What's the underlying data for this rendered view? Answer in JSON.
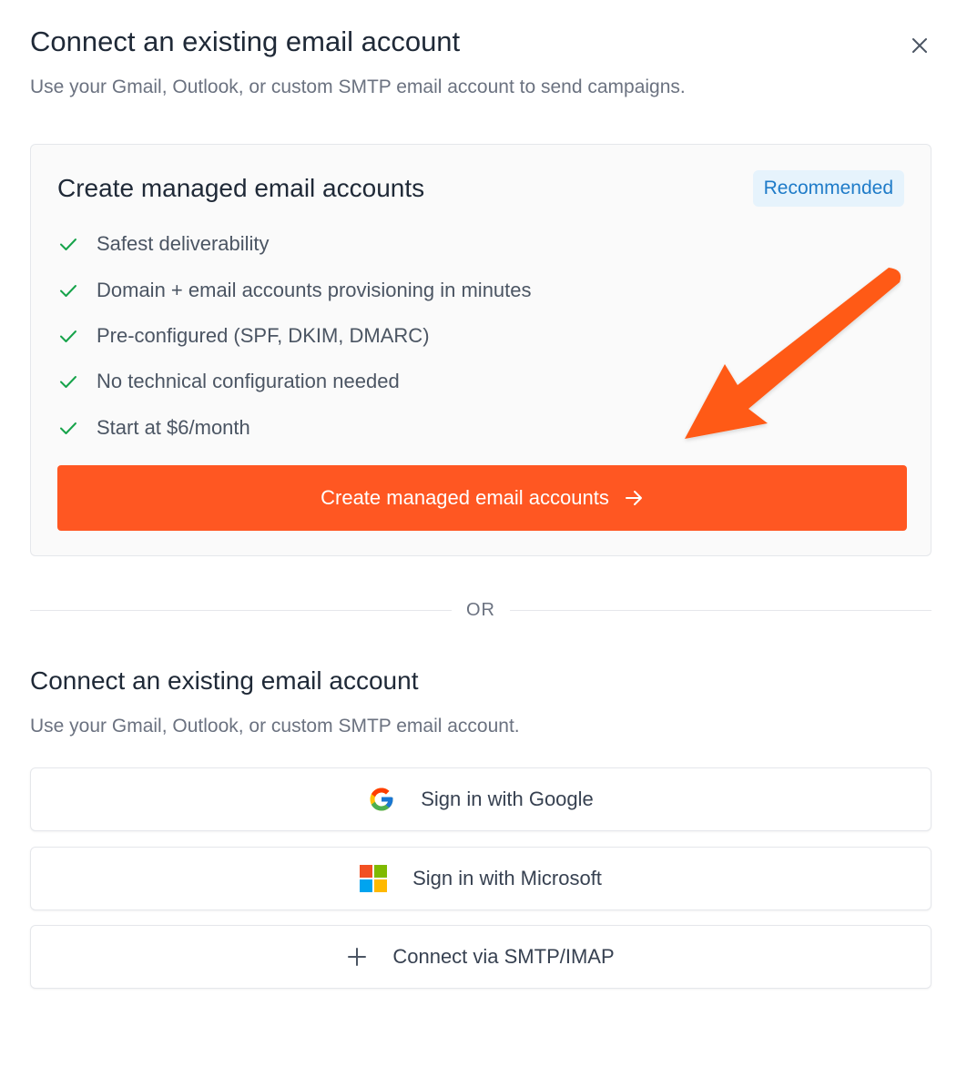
{
  "modal": {
    "title": "Connect an existing email account",
    "subtitle": "Use your Gmail, Outlook, or custom SMTP email account to send campaigns.",
    "close_icon": "close-icon"
  },
  "managed": {
    "title": "Create managed email accounts",
    "badge": "Recommended",
    "features": [
      "Safest deliverability",
      "Domain + email accounts provisioning in minutes",
      "Pre-configured (SPF, DKIM, DMARC)",
      "No technical configuration needed",
      "Start at $6/month"
    ],
    "cta_label": "Create managed email accounts",
    "cta_icon": "arrow-right-icon"
  },
  "divider": {
    "label": "OR"
  },
  "existing": {
    "title": "Connect an existing email account",
    "subtitle": "Use your Gmail, Outlook, or custom SMTP email account.",
    "buttons": [
      {
        "label": "Sign in with Google",
        "icon": "google-icon"
      },
      {
        "label": "Sign in with Microsoft",
        "icon": "microsoft-icon"
      },
      {
        "label": "Connect via SMTP/IMAP",
        "icon": "plus-icon"
      }
    ]
  },
  "colors": {
    "accent": "#ff5722",
    "check": "#16a34a",
    "badge_text": "#1e7bc8",
    "badge_bg": "#e6f3fc"
  }
}
